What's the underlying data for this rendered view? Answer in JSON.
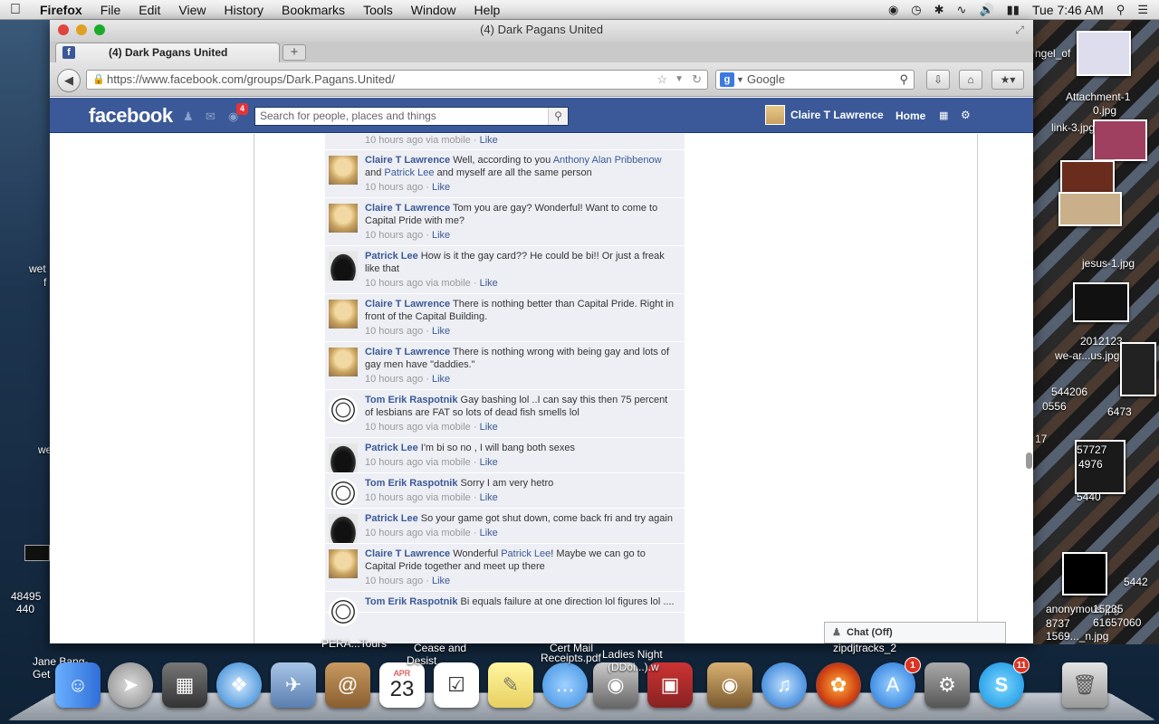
{
  "menubar": {
    "app": "Firefox",
    "items": [
      "File",
      "Edit",
      "View",
      "History",
      "Bookmarks",
      "Tools",
      "Window",
      "Help"
    ],
    "clock": "Tue 7:46 AM"
  },
  "desktop_left": [
    "wet",
    "f",
    "we",
    "48495",
    "440",
    "Jane Bang-",
    "Get"
  ],
  "window": {
    "title": "(4) Dark Pagans United",
    "tab_title": "(4) Dark Pagans United",
    "url": "https://www.facebook.com/groups/Dark.Pagans.United/",
    "search_placeholder": "Google"
  },
  "facebook": {
    "logo": "facebook",
    "notif_count": "4",
    "search_placeholder": "Search for people, places and things",
    "user": "Claire T Lawrence",
    "home": "Home",
    "chat": "Chat (Off)"
  },
  "first_row": {
    "time": "10 hours ago via mobile",
    "like": "Like"
  },
  "comments": [
    {
      "avatar": "claire",
      "name": "Claire T Lawrence",
      "pre": "Well, according to you ",
      "link1": "Anthony Alan Pribbenow",
      "mid": " and ",
      "link2": "Patrick Lee",
      "post": " and myself are all the same person",
      "time": "10 hours ago",
      "like": "Like"
    },
    {
      "avatar": "claire",
      "name": "Claire T Lawrence",
      "pre": "Tom you are gay? Wonderful! Want to come to Capital Pride with me?",
      "time": "10 hours ago",
      "like": "Like"
    },
    {
      "avatar": "patrick",
      "name": "Patrick Lee",
      "pre": "How is it the gay card?? He could be bi!! Or just a freak like that",
      "time": "10 hours ago via mobile",
      "like": "Like"
    },
    {
      "avatar": "claire",
      "name": "Claire T Lawrence",
      "pre": "There is nothing better than Capital Pride. Right in front of the Capital Building.",
      "time": "10 hours ago",
      "like": "Like"
    },
    {
      "avatar": "claire",
      "name": "Claire T Lawrence",
      "pre": "There is nothing wrong with being gay and lots of gay men have \"daddies.\"",
      "time": "10 hours ago",
      "like": "Like"
    },
    {
      "avatar": "tom",
      "name": "Tom Erik Raspotnik",
      "pre": "Gay bashing lol ..I can say this then 75 percent of lesbians are FAT so lots of dead fish smells lol",
      "time": "10 hours ago via mobile",
      "like": "Like"
    },
    {
      "avatar": "patrick",
      "name": "Patrick Lee",
      "pre": "I'm bi so no , I will bang both sexes",
      "time": "10 hours ago via mobile",
      "like": "Like"
    },
    {
      "avatar": "tom",
      "name": "Tom Erik Raspotnik",
      "pre": "Sorry I am very hetro",
      "time": "10 hours ago via mobile",
      "like": "Like"
    },
    {
      "avatar": "patrick",
      "name": "Patrick Lee",
      "pre": "So your game got shut down, come back fri and try again",
      "time": "10 hours ago via mobile",
      "like": "Like"
    },
    {
      "avatar": "claire",
      "name": "Claire T Lawrence",
      "pre": "Wonderful ",
      "link1": "Patrick Lee",
      "post": "! Maybe we can go to Capital Pride together and meet up there",
      "time": "10 hours ago",
      "like": "Like"
    },
    {
      "avatar": "tom",
      "name": "Tom Erik Raspotnik",
      "pre": "Bi equals failure at one direction lol figures lol ....",
      "time": "",
      "like": ""
    }
  ],
  "collage_labels": [
    "Attachment-1",
    "0.jpg",
    "ngel_of",
    "link-3.jpg",
    "jesus-1.jpg",
    "we-ar...us.jpg",
    "2012123",
    "544206",
    "0556",
    "6473",
    "57727",
    "4976",
    "5440",
    "5442",
    "17",
    "8737",
    "1569..._n.jpg",
    "anonymous.jpg",
    "15235",
    "61657060"
  ],
  "dock_labels": [
    "Cert Mail",
    "Receipts.pdf",
    "Ladies Night",
    "(DDoi...).w",
    "zipdjtracks_2",
    "Cease and",
    "Desist",
    "PERA...Tours"
  ],
  "dock_badges": {
    "appstore": "1",
    "skype": "11"
  },
  "calendar": {
    "month": "APR",
    "day": "23"
  }
}
